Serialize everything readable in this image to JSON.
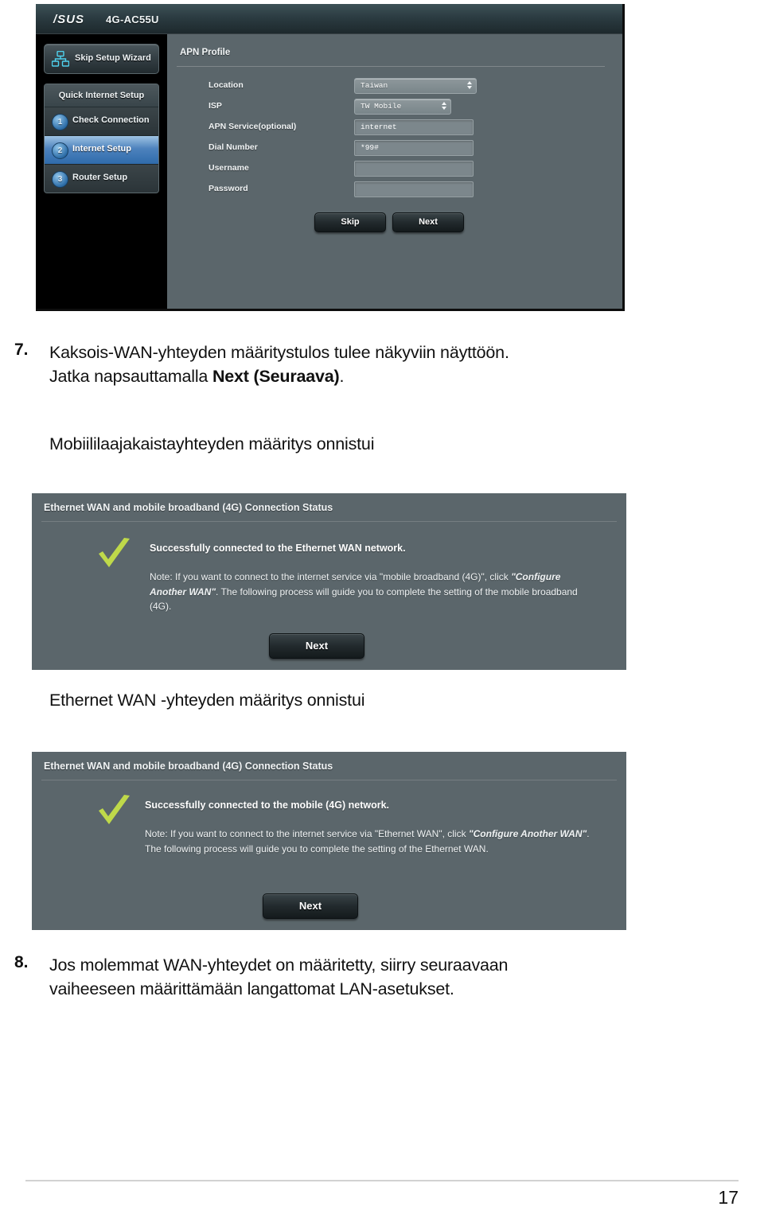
{
  "document": {
    "page_number": "17"
  },
  "router_ui": {
    "brand": "/SUS",
    "model": "4G-AC55U",
    "skip_wizard_label": "Skip Setup Wizard",
    "quick_internet_setup_label": "Quick Internet Setup",
    "steps": [
      {
        "num": "1",
        "label": "Check Connection",
        "active": false
      },
      {
        "num": "2",
        "label": "Internet Setup",
        "active": true
      },
      {
        "num": "3",
        "label": "Router Setup",
        "active": false
      }
    ],
    "apn_profile_title": "APN Profile",
    "fields": [
      {
        "label": "Location",
        "value": "Taiwan",
        "type": "select"
      },
      {
        "label": "ISP",
        "value": "TW Mobile",
        "type": "select"
      },
      {
        "label": "APN Service(optional)",
        "value": "internet",
        "type": "text"
      },
      {
        "label": "Dial Number",
        "value": "*99#",
        "type": "text"
      },
      {
        "label": "Username",
        "value": "",
        "type": "text"
      },
      {
        "label": "Password",
        "value": "",
        "type": "password"
      }
    ],
    "skip_button": "Skip",
    "next_button": "Next"
  },
  "status_ethernet": {
    "header": "Ethernet WAN and mobile broadband (4G) Connection Status",
    "success": "Successfully connected to the Ethernet WAN network.",
    "note_part1": "Note: If you want to connect to the internet service via \"mobile broadband (4G)\", click ",
    "note_emphasis": "\"Configure Another WAN\"",
    "note_part2": ". The following process will guide you to complete the setting of the mobile broadband (4G).",
    "next_button": "Next",
    "check_color": "#bfd94a"
  },
  "status_mobile": {
    "header": "Ethernet WAN and mobile broadband (4G) Connection Status",
    "success": "Successfully connected to the mobile (4G) network.",
    "note_part1": "Note: If you want to connect to the internet service via \"Ethernet WAN\", click ",
    "note_emphasis": "\"Configure Another WAN\"",
    "note_part2": ". The following process will guide you to complete the setting of the Ethernet WAN.",
    "next_button": "Next",
    "check_color": "#bfd94a"
  },
  "instructions": {
    "step7_number": "7.",
    "step7_line1": "Kaksois-WAN-yhteyden määritystulos tulee näkyviin näyttöön.",
    "step7_line2_pre": "Jatka napsauttamalla ",
    "step7_line2_bold": "Next (Seuraava)",
    "step7_line2_post": ".",
    "caption_mobile": "Mobiililaajakaistayhteyden määritys onnistui",
    "caption_ethernet": "Ethernet WAN -yhteyden määritys onnistui",
    "step8_number": "8.",
    "step8_line1": "Jos molemmat WAN-yhteydet on määritetty, siirry seuraavaan",
    "step8_line2": "vaiheeseen määrittämään langattomat LAN-asetukset."
  }
}
